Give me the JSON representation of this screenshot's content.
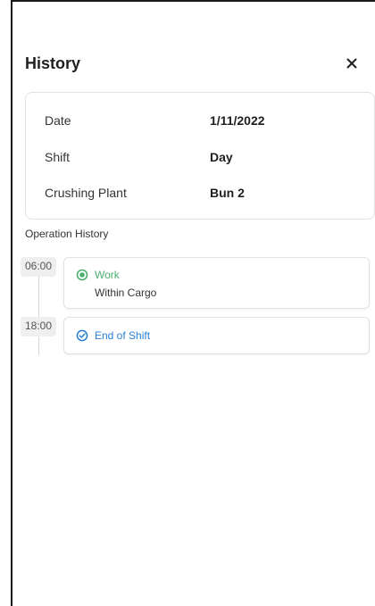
{
  "header": {
    "title": "History"
  },
  "details": [
    {
      "label": "Date",
      "value": "1/11/2022"
    },
    {
      "label": "Shift",
      "value": "Day"
    },
    {
      "label": "Crushing Plant",
      "value": "Bun 2"
    }
  ],
  "operation_history": {
    "title": "Operation History",
    "events": [
      {
        "time": "06:00",
        "status": "Work",
        "detail": "Within Cargo",
        "icon": "status-circle-icon",
        "color": "#4caf6e"
      },
      {
        "time": "18:00",
        "status": "End of Shift",
        "icon": "check-circle-icon",
        "color": "#2a7fd4"
      }
    ]
  },
  "colors": {
    "work": "#4caf6e",
    "end_of_shift": "#2a7fd4",
    "border": "#e2e2e2"
  }
}
